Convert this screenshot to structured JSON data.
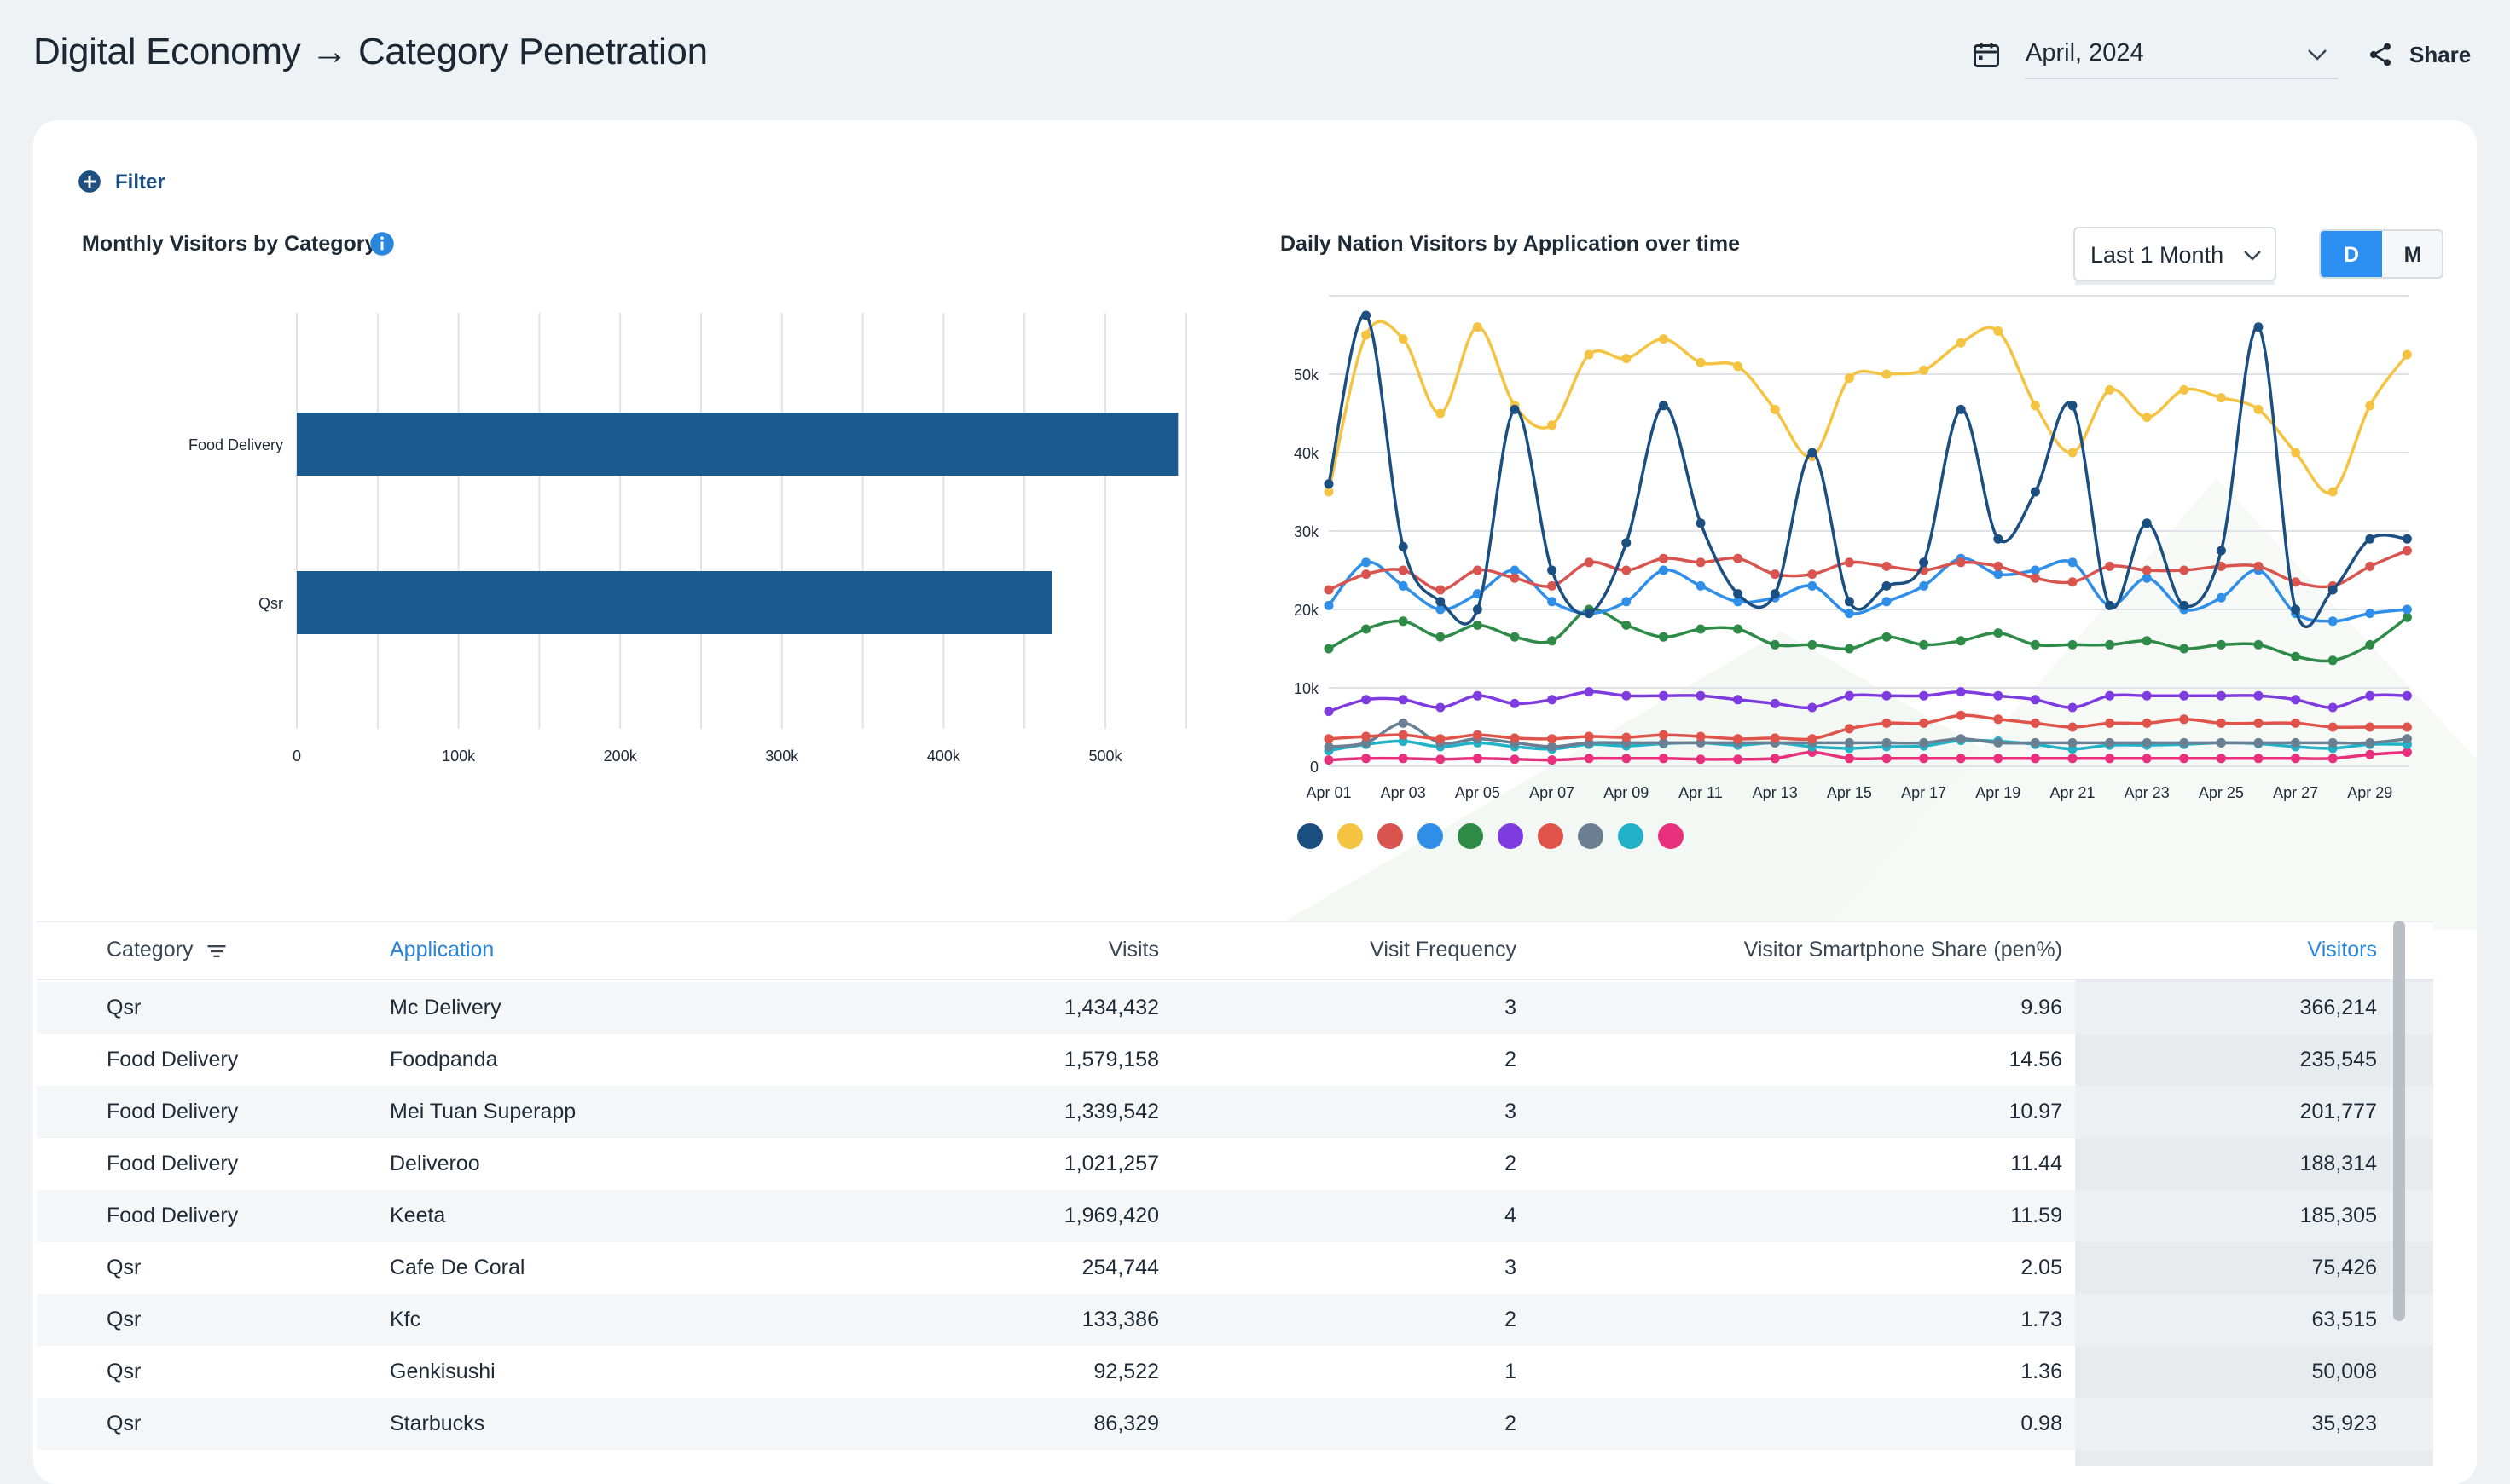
{
  "header": {
    "title": "Digital Economy → Category Penetration",
    "date_value": "April, 2024",
    "share_label": "Share",
    "icons": [
      "calendar-icon",
      "chevron-down-icon",
      "share-icon"
    ]
  },
  "filter": {
    "label": "Filter",
    "icon": "plus-circle-icon"
  },
  "bar_panel": {
    "title": "Monthly Visitors by Category",
    "icon": "info-icon"
  },
  "line_panel": {
    "title": "Daily Nation Visitors by Application over time",
    "range_value": "Last 1 Month",
    "toggle": {
      "d": "D",
      "m": "M",
      "selected": "D"
    }
  },
  "chart_data": [
    {
      "type": "bar",
      "orientation": "horizontal",
      "categories": [
        "Food Delivery",
        "Qsr"
      ],
      "values": [
        545000,
        467000
      ],
      "xlim": [
        0,
        550000
      ],
      "xticks": [
        "0",
        "100k",
        "200k",
        "300k",
        "400k",
        "500k"
      ],
      "grid": true,
      "color": "#1a5a8f"
    },
    {
      "type": "line",
      "x": [
        "Apr 01",
        "Apr 02",
        "Apr 03",
        "Apr 04",
        "Apr 05",
        "Apr 06",
        "Apr 07",
        "Apr 08",
        "Apr 09",
        "Apr 10",
        "Apr 11",
        "Apr 12",
        "Apr 13",
        "Apr 14",
        "Apr 15",
        "Apr 16",
        "Apr 17",
        "Apr 18",
        "Apr 19",
        "Apr 20",
        "Apr 21",
        "Apr 22",
        "Apr 23",
        "Apr 24",
        "Apr 25",
        "Apr 26",
        "Apr 27",
        "Apr 28",
        "Apr 29",
        "Apr 30"
      ],
      "xtick_labels": [
        "Apr 01",
        "Apr 03",
        "Apr 05",
        "Apr 07",
        "Apr 09",
        "Apr 11",
        "Apr 13",
        "Apr 15",
        "Apr 17",
        "Apr 19",
        "Apr 21",
        "Apr 23",
        "Apr 25",
        "Apr 27",
        "Apr 29"
      ],
      "ylim": [
        0,
        60000
      ],
      "yticks": [
        "0",
        "10k",
        "20k",
        "30k",
        "40k",
        "50k"
      ],
      "grid": true,
      "legend_position": "bottom-left",
      "series": [
        {
          "color": "#1b4f82",
          "values": [
            36000,
            57500,
            28000,
            21000,
            20000,
            45500,
            25000,
            19500,
            28500,
            46000,
            31000,
            22000,
            22000,
            40000,
            21000,
            23000,
            26000,
            45500,
            29000,
            35000,
            46000,
            20500,
            31000,
            20500,
            27500,
            56000,
            20000,
            22500,
            29000,
            29000
          ]
        },
        {
          "color": "#f5c342",
          "values": [
            35000,
            55000,
            54500,
            45000,
            56000,
            46000,
            43500,
            52500,
            52000,
            54500,
            51500,
            51000,
            45500,
            39500,
            49500,
            50000,
            50500,
            54000,
            55500,
            46000,
            40000,
            48000,
            44500,
            48000,
            47000,
            45500,
            40000,
            35000,
            46000,
            52500
          ]
        },
        {
          "color": "#d9534f",
          "values": [
            22500,
            24500,
            25000,
            22500,
            25000,
            24000,
            23000,
            26000,
            25000,
            26500,
            26000,
            26500,
            24500,
            24500,
            26000,
            25500,
            25000,
            26000,
            25500,
            24000,
            23500,
            25500,
            25000,
            25000,
            25500,
            25500,
            23500,
            23000,
            25500,
            27500
          ]
        },
        {
          "color": "#2f8fe8",
          "values": [
            20500,
            26000,
            23000,
            20000,
            22000,
            25000,
            21000,
            19500,
            21000,
            25000,
            23000,
            21000,
            21500,
            23000,
            19500,
            21000,
            23000,
            26500,
            24500,
            25000,
            26000,
            20500,
            24000,
            20000,
            21500,
            25000,
            19500,
            18500,
            19500,
            20000
          ]
        },
        {
          "color": "#2e8b47",
          "values": [
            15000,
            17500,
            18500,
            16500,
            18000,
            16500,
            16000,
            20000,
            18000,
            16500,
            17500,
            17500,
            15500,
            15500,
            15000,
            16500,
            15500,
            16000,
            17000,
            15500,
            15500,
            15500,
            16000,
            15000,
            15500,
            15500,
            14000,
            13500,
            15500,
            19000
          ]
        },
        {
          "color": "#7e3ce0",
          "values": [
            7000,
            8500,
            8500,
            7500,
            9000,
            8000,
            8500,
            9500,
            9000,
            9000,
            9000,
            8500,
            8000,
            7500,
            9000,
            9000,
            9000,
            9500,
            9000,
            8500,
            7500,
            9000,
            9000,
            9000,
            9000,
            9000,
            8500,
            7500,
            9000,
            9000
          ]
        },
        {
          "color": "#e0534a",
          "values": [
            3500,
            3800,
            4000,
            3500,
            4000,
            3600,
            3500,
            3800,
            3700,
            4000,
            3800,
            3500,
            3600,
            3500,
            4800,
            5500,
            5500,
            6500,
            6000,
            5500,
            5000,
            5500,
            5500,
            6000,
            5500,
            5500,
            5500,
            5000,
            5000,
            5000
          ]
        },
        {
          "color": "#6b7f93",
          "values": [
            2500,
            3000,
            5500,
            3000,
            3500,
            3000,
            2500,
            3000,
            3000,
            3000,
            3000,
            3000,
            3000,
            3000,
            3000,
            3000,
            3000,
            3500,
            3000,
            3000,
            3000,
            3000,
            3000,
            3000,
            3000,
            3000,
            3000,
            3000,
            3000,
            3500
          ]
        },
        {
          "color": "#22b2c8",
          "values": [
            2000,
            2800,
            3200,
            2500,
            3000,
            2500,
            2200,
            2800,
            2600,
            2900,
            3000,
            2700,
            3000,
            2500,
            2300,
            2500,
            2600,
            3300,
            3200,
            2800,
            2200,
            2700,
            2700,
            2800,
            3000,
            2900,
            2500,
            2300,
            2800,
            2800
          ]
        },
        {
          "color": "#e8307c",
          "values": [
            800,
            1000,
            1000,
            900,
            1000,
            900,
            800,
            1000,
            1000,
            1000,
            900,
            900,
            1000,
            1800,
            1000,
            1000,
            1000,
            1000,
            1000,
            1000,
            1000,
            1000,
            1000,
            1000,
            1000,
            1000,
            1000,
            1000,
            1500,
            1800
          ]
        }
      ]
    }
  ],
  "table": {
    "columns": [
      "Category",
      "Application",
      "Visits",
      "Visit Frequency",
      "Visitor Smartphone Share (pen%)",
      "Visitors"
    ],
    "rows": [
      [
        "Qsr",
        "Mc Delivery",
        "1,434,432",
        "3",
        "9.96",
        "366,214"
      ],
      [
        "Food Delivery",
        "Foodpanda",
        "1,579,158",
        "2",
        "14.56",
        "235,545"
      ],
      [
        "Food Delivery",
        "Mei Tuan Superapp",
        "1,339,542",
        "3",
        "10.97",
        "201,777"
      ],
      [
        "Food Delivery",
        "Deliveroo",
        "1,021,257",
        "2",
        "11.44",
        "188,314"
      ],
      [
        "Food Delivery",
        "Keeta",
        "1,969,420",
        "4",
        "11.59",
        "185,305"
      ],
      [
        "Qsr",
        "Cafe De Coral",
        "254,744",
        "3",
        "2.05",
        "75,426"
      ],
      [
        "Qsr",
        "Kfc",
        "133,386",
        "2",
        "1.73",
        "63,515"
      ],
      [
        "Qsr",
        "Genkisushi",
        "92,522",
        "1",
        "1.36",
        "50,008"
      ],
      [
        "Qsr",
        "Starbucks",
        "86,329",
        "2",
        "0.98",
        "35,923"
      ]
    ]
  }
}
